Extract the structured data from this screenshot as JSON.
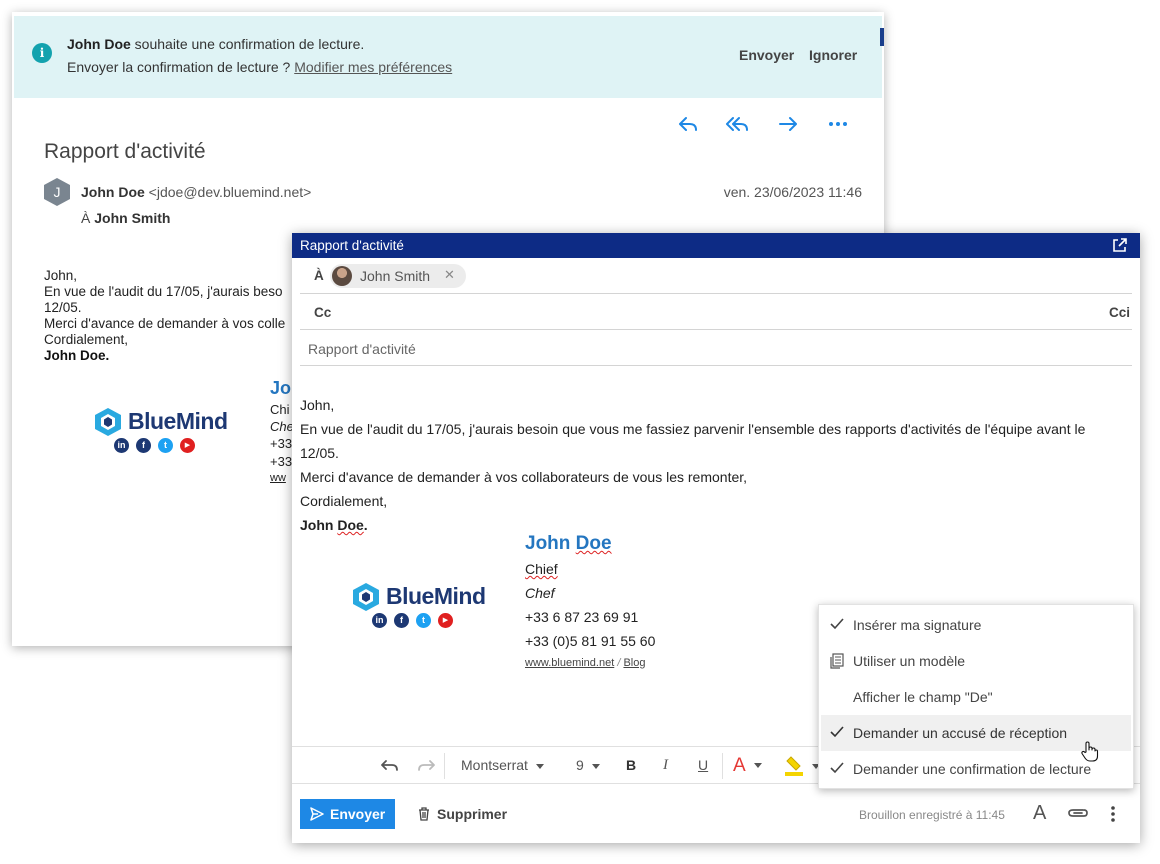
{
  "read_window": {
    "banner": {
      "sender_name": "John Doe",
      "request_text": " souhaite une confirmation de lecture.",
      "question": "Envoyer la confirmation de lecture ? ",
      "prefs_link": "Modifier mes préférences",
      "send_label": "Envoyer",
      "ignore_label": "Ignorer"
    },
    "subject": "Rapport d'activité",
    "avatar_initial": "J",
    "sender_name": "John Doe",
    "sender_email": "<jdoe@dev.bluemind.net>",
    "date": "ven. 23/06/2023 11:46",
    "to_prefix": "À ",
    "to_name": "John Smith",
    "body": {
      "line1": "John,",
      "line2": "En vue de l'audit du 17/05, j'aurais beso",
      "line3": "12/05.",
      "line4": "Merci d'avance de demander à vos colle",
      "line5": "Cordialement,",
      "line6": "John Doe."
    },
    "signature_fragments": {
      "name": "Jo",
      "title": "Chi",
      "title_italic": "Che",
      "phone1": "+33",
      "phone2": "+33",
      "web": "ww"
    }
  },
  "compose": {
    "title": "Rapport d'activité",
    "to_label": "À",
    "recipient": "John Smith",
    "cc_label": "Cc",
    "bcc_label": "Cci",
    "subject": "Rapport d'activité",
    "body": {
      "line1": "John,",
      "line2": "En vue de l'audit du 17/05, j'aurais besoin que vous me fassiez parvenir l'ensemble des rapports d'activités de l'équipe avant le",
      "line3": "12/05.",
      "line4": "Merci d'avance de demander à vos collaborateurs de vous les remonter,",
      "line5": "Cordialement,",
      "line6_a": "John ",
      "line6_b": "Doe",
      "line6_c": "."
    },
    "signature": {
      "name_a": "John ",
      "name_b": "Doe",
      "title": "Chief",
      "title_italic": "Chef",
      "phone1": "+33 6 87 23 69 91",
      "phone2": "+33 (0)5 81 91 55 60",
      "website": "www.bluemind.net",
      "separator": " / ",
      "blog": "Blog"
    },
    "logo": {
      "wordmark": "BlueMind",
      "socials": [
        "in",
        "f",
        "t",
        "▶"
      ]
    },
    "toolbar": {
      "font": "Montserrat",
      "size": "9",
      "bold": "B",
      "italic": "I",
      "underline": "U",
      "font_color": "A"
    },
    "send_label": "Envoyer",
    "delete_label": "Supprimer",
    "draft_status": "Brouillon enregistré à 11:45",
    "text_format_icon": "A"
  },
  "menu": {
    "items": [
      {
        "label": "Insérer ma signature",
        "icon": "check-icon"
      },
      {
        "label": "Utiliser un modèle",
        "icon": "template-icon"
      },
      {
        "label": "Afficher le champ \"De\"",
        "icon": ""
      },
      {
        "label": "Demander un accusé de réception",
        "icon": "check-icon"
      },
      {
        "label": "Demander une confirmation de lecture",
        "icon": "check-icon"
      }
    ]
  },
  "colors": {
    "title_bar": "#0d2b85",
    "accent_blue": "#1e88e5",
    "banner_bg": "#dff3f5",
    "info_teal": "#13a2ae",
    "signature_name": "#2476c0",
    "font_color_red": "#e53935",
    "highlight_yellow": "#f4d400"
  }
}
